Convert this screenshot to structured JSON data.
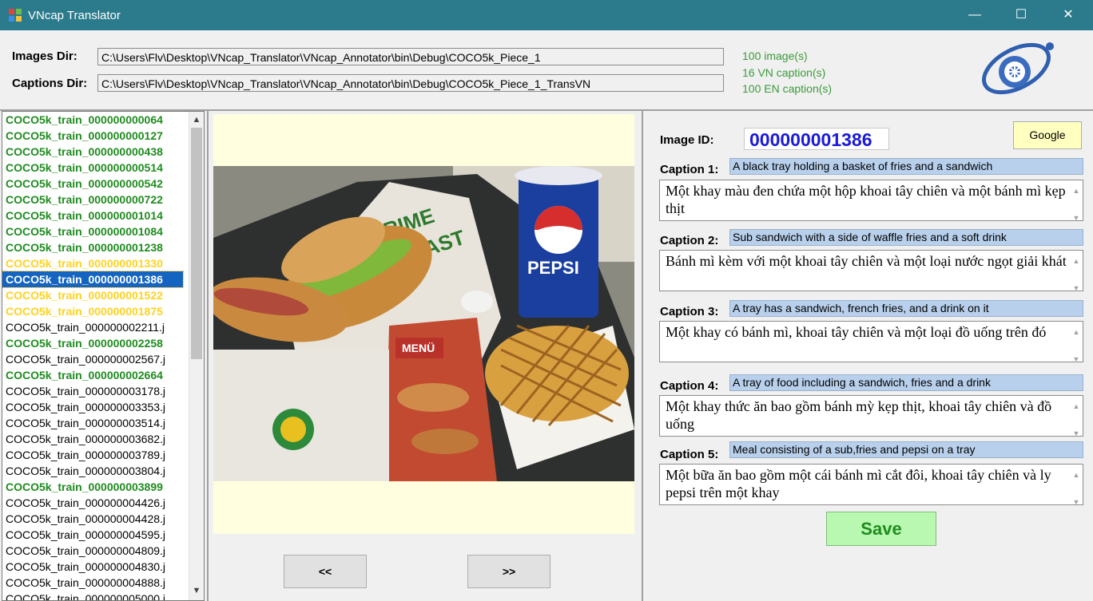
{
  "window": {
    "title": "VNcap Translator",
    "minimize": "—",
    "maximize": "☐",
    "close": "✕"
  },
  "dirs": {
    "images_label": "Images Dir:",
    "images_path": "C:\\Users\\Flv\\Desktop\\VNcap_Translator\\VNcap_Annotator\\bin\\Debug\\COCO5k_Piece_1",
    "captions_label": "Captions Dir:",
    "captions_path": "C:\\Users\\Flv\\Desktop\\VNcap_Translator\\VNcap_Annotator\\bin\\Debug\\COCO5k_Piece_1_TransVN"
  },
  "stats": {
    "images": "100 image(s)",
    "vn": "16 VN caption(s)",
    "en": "100 EN caption(s)"
  },
  "file_list": [
    {
      "name": "COCO5k_train_000000000064",
      "status": "green"
    },
    {
      "name": "COCO5k_train_000000000127",
      "status": "green"
    },
    {
      "name": "COCO5k_train_000000000438",
      "status": "green"
    },
    {
      "name": "COCO5k_train_000000000514",
      "status": "green"
    },
    {
      "name": "COCO5k_train_000000000542",
      "status": "green"
    },
    {
      "name": "COCO5k_train_000000000722",
      "status": "green"
    },
    {
      "name": "COCO5k_train_000000001014",
      "status": "green"
    },
    {
      "name": "COCO5k_train_000000001084",
      "status": "green"
    },
    {
      "name": "COCO5k_train_000000001238",
      "status": "green"
    },
    {
      "name": "COCO5k_train_000000001330",
      "status": "yellow"
    },
    {
      "name": "COCO5k_train_000000001386",
      "status": "selected"
    },
    {
      "name": "COCO5k_train_000000001522",
      "status": "yellow"
    },
    {
      "name": "COCO5k_train_000000001875",
      "status": "yellow"
    },
    {
      "name": "COCO5k_train_000000002211.j",
      "status": "plain"
    },
    {
      "name": "COCO5k_train_000000002258",
      "status": "green"
    },
    {
      "name": "COCO5k_train_000000002567.j",
      "status": "plain"
    },
    {
      "name": "COCO5k_train_000000002664",
      "status": "green"
    },
    {
      "name": "COCO5k_train_000000003178.j",
      "status": "plain"
    },
    {
      "name": "COCO5k_train_000000003353.j",
      "status": "plain"
    },
    {
      "name": "COCO5k_train_000000003514.j",
      "status": "plain"
    },
    {
      "name": "COCO5k_train_000000003682.j",
      "status": "plain"
    },
    {
      "name": "COCO5k_train_000000003789.j",
      "status": "plain"
    },
    {
      "name": "COCO5k_train_000000003804.j",
      "status": "plain"
    },
    {
      "name": "COCO5k_train_000000003899",
      "status": "green"
    },
    {
      "name": "COCO5k_train_000000004426.j",
      "status": "plain"
    },
    {
      "name": "COCO5k_train_000000004428.j",
      "status": "plain"
    },
    {
      "name": "COCO5k_train_000000004595.j",
      "status": "plain"
    },
    {
      "name": "COCO5k_train_000000004809.j",
      "status": "plain"
    },
    {
      "name": "COCO5k_train_000000004830.j",
      "status": "plain"
    },
    {
      "name": "COCO5k_train_000000004888.j",
      "status": "plain"
    },
    {
      "name": "COCO5k_train_000000005000.j",
      "status": "plain"
    }
  ],
  "colors": {
    "green": "#1e8c1e",
    "yellow": "#ffd21e",
    "selected_bg": "#1565c0",
    "titlebar": "#2b7b8c",
    "image_bg": "#ffffe0"
  },
  "photo": {
    "menu_text": "MENÜ",
    "brand": "PEPSI",
    "sign": "PRIME",
    "sign2": "ROAST"
  },
  "nav": {
    "prev": "<<",
    "next": ">>"
  },
  "detail": {
    "image_id_label": "Image ID:",
    "image_id": "000000001386",
    "google_label": "Google",
    "save_label": "Save",
    "captions": [
      {
        "label": "Caption 1:",
        "en": "A black tray holding a basket of fries and a sandwich",
        "vn": "Một khay màu đen chứa một hộp khoai tây chiên và một bánh mì kẹp thịt"
      },
      {
        "label": "Caption 2:",
        "en": "Sub sandwich with a side of waffle fries and a soft drink",
        "vn": "Bánh mì kèm với một khoai tây chiên và một loại nước ngọt giải khát"
      },
      {
        "label": "Caption 3:",
        "en": "A tray has a sandwich, french fries, and a drink on it",
        "vn": "Một khay có bánh mì, khoai tây chiên và một loại đồ uống trên đó"
      },
      {
        "label": "Caption 4:",
        "en": "A tray of food including a sandwich, fries and a drink",
        "vn": "Một khay thức ăn bao gồm bánh mỳ kẹp thịt, khoai tây chiên và đồ uống"
      },
      {
        "label": "Caption 5:",
        "en": "Meal consisting of a sub,fries and pepsi on a tray",
        "vn": "Một bữa ăn bao gồm một cái bánh mì cắt đôi, khoai tây chiên và ly pepsi trên một khay"
      }
    ]
  }
}
